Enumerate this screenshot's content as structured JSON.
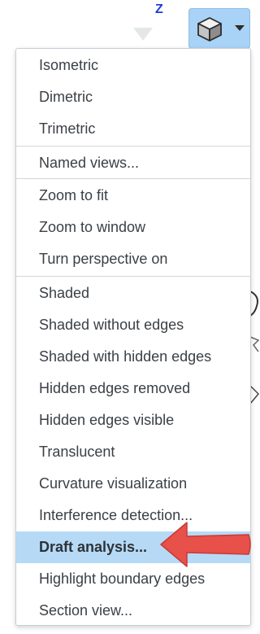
{
  "axis_label": "Z",
  "icons": {
    "view_cube": "cube-icon",
    "dropdown": "caret-down-icon",
    "triad": "triad-pointer-icon",
    "annotation": "red-arrow-icon"
  },
  "colors": {
    "accent": "#a9d3f6",
    "selected_row": "#b6daf6",
    "axis_label": "#1f3bd6",
    "arrow": "#e8504a",
    "menu_text": "#3b4046"
  },
  "menu": {
    "groups": [
      {
        "items": [
          {
            "label": "Isometric"
          },
          {
            "label": "Dimetric"
          },
          {
            "label": "Trimetric"
          }
        ]
      },
      {
        "items": [
          {
            "label": "Named views..."
          }
        ]
      },
      {
        "items": [
          {
            "label": "Zoom to fit"
          },
          {
            "label": "Zoom to window"
          },
          {
            "label": "Turn perspective on"
          }
        ]
      },
      {
        "items": [
          {
            "label": "Shaded"
          },
          {
            "label": "Shaded without edges"
          },
          {
            "label": "Shaded with hidden edges"
          },
          {
            "label": "Hidden edges removed"
          },
          {
            "label": "Hidden edges visible"
          },
          {
            "label": "Translucent"
          },
          {
            "label": "Curvature visualization"
          },
          {
            "label": "Interference detection..."
          },
          {
            "label": "Draft analysis...",
            "selected": true
          },
          {
            "label": "Highlight boundary edges"
          },
          {
            "label": "Section view..."
          }
        ]
      }
    ]
  }
}
